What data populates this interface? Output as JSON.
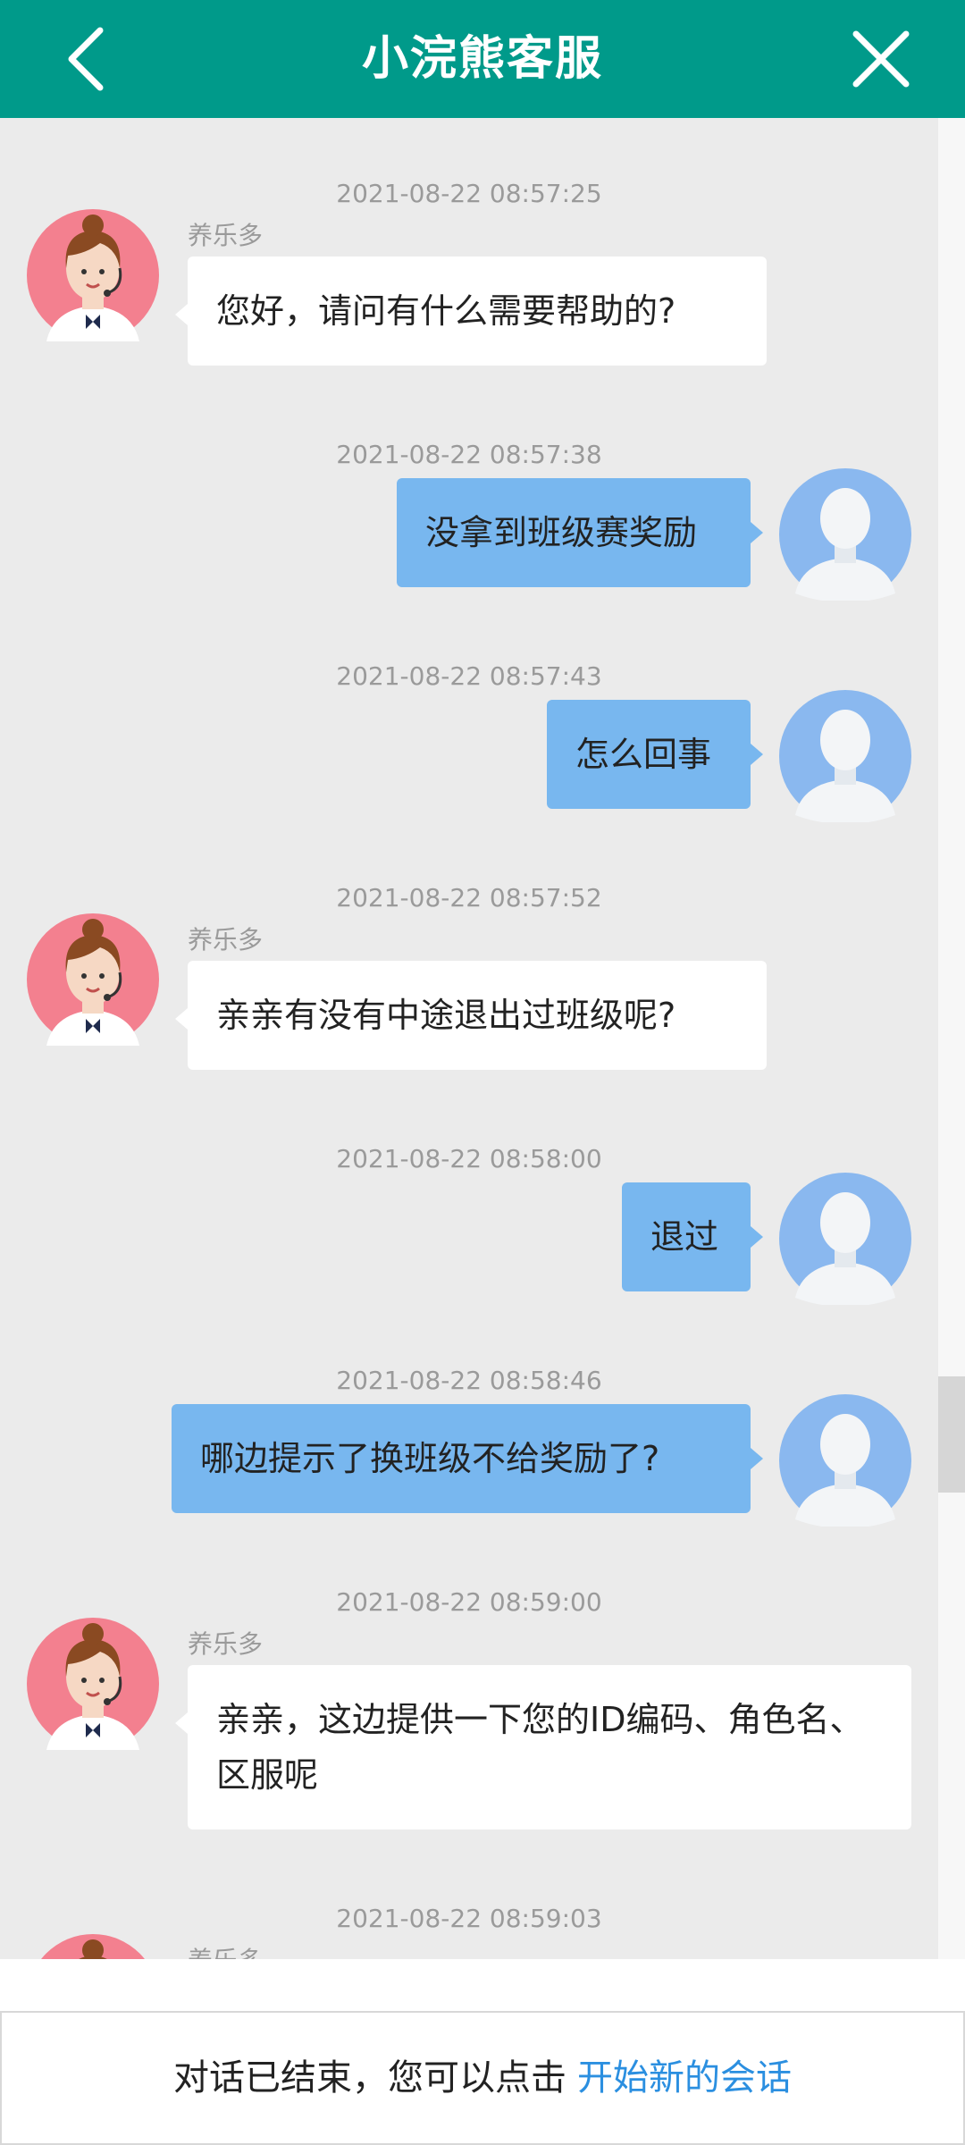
{
  "header": {
    "title": "小浣熊客服",
    "back_icon": "chevron-left-icon",
    "close_icon": "close-icon",
    "color": "#009a8a"
  },
  "messages": [
    {
      "time": "2021-08-22 08:57:25",
      "side": "left",
      "name": "养乐多",
      "text": "您好，请问有什么需要帮助的?"
    },
    {
      "time": "2021-08-22 08:57:38",
      "side": "right",
      "text": "没拿到班级赛奖励"
    },
    {
      "time": "2021-08-22 08:57:43",
      "side": "right",
      "text": "怎么回事"
    },
    {
      "time": "2021-08-22 08:57:52",
      "side": "left",
      "name": "养乐多",
      "text": "亲亲有没有中途退出过班级呢?"
    },
    {
      "time": "2021-08-22 08:58:00",
      "side": "right",
      "text": "退过"
    },
    {
      "time": "2021-08-22 08:58:46",
      "side": "right",
      "text": "哪边提示了换班级不给奖励了?"
    },
    {
      "time": "2021-08-22 08:59:00",
      "side": "left",
      "name": "养乐多",
      "text": "亲亲，这边提供一下您的ID编码、角色名、区服呢"
    },
    {
      "time": "2021-08-22 08:59:03",
      "side": "left",
      "name": "养乐多",
      "text": ""
    }
  ],
  "footer": {
    "text": "对话已结束，您可以点击",
    "link": "开始新的会话",
    "link_color": "#2b8fe0"
  },
  "colors": {
    "agent_bubble": "#ffffff",
    "user_bubble": "#78b7ef",
    "background": "#ebebeb"
  }
}
